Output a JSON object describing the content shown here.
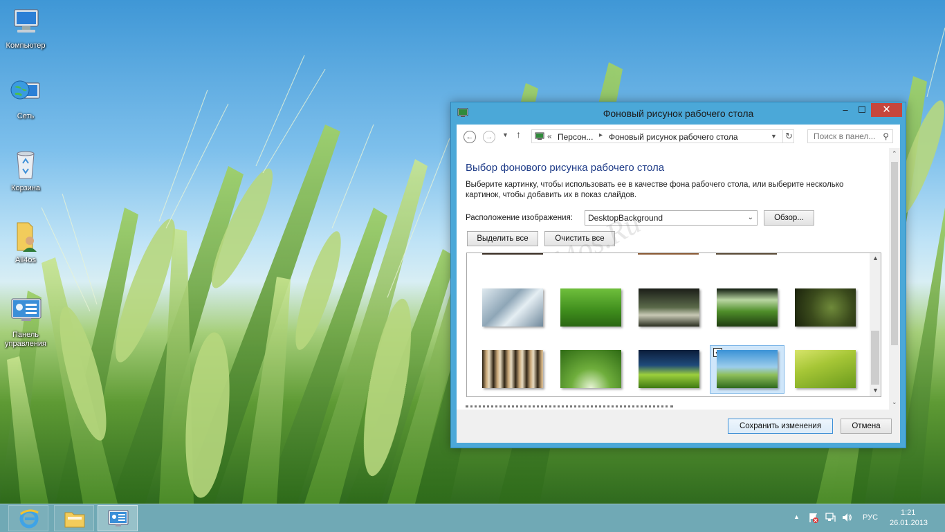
{
  "desktop": {
    "icons": [
      {
        "label": "Компьютер",
        "icon": "computer-icon"
      },
      {
        "label": "Сеть",
        "icon": "network-globe-icon"
      },
      {
        "label": "Корзина",
        "icon": "recycle-bin-icon"
      },
      {
        "label": "All4os",
        "icon": "user-folder-icon"
      },
      {
        "label_line1": "Панель",
        "label_line2": "управления",
        "icon": "control-panel-icon"
      }
    ]
  },
  "window": {
    "title": "Фоновый рисунок рабочего стола",
    "controls": {
      "minimize": "–",
      "maximize": "☐",
      "close": "✕"
    },
    "breadcrumb": {
      "prefix": "«",
      "items": [
        "Персон...",
        "Фоновый рисунок рабочего стола"
      ]
    },
    "search_placeholder": "Поиск в панел...",
    "heading": "Выбор фонового рисунка рабочего стола",
    "description": "Выберите картинку, чтобы использовать ее в качестве фона рабочего стола, или выберите несколько картинок, чтобы добавить их в показ слайдов.",
    "location_label": "Расположение изображения:",
    "location_value": "DesktopBackground",
    "browse_button": "Обзор...",
    "select_all_button": "Выделить все",
    "clear_all_button": "Очистить все",
    "watermark": "All4os.Ru",
    "wallpapers_selected_index": 8,
    "save_button": "Сохранить изменения",
    "cancel_button": "Отмена"
  },
  "taskbar": {
    "apps": [
      {
        "icon": "internet-explorer-icon",
        "active": false
      },
      {
        "icon": "file-explorer-icon",
        "active": false
      },
      {
        "icon": "control-panel-icon",
        "active": true
      }
    ],
    "tray": {
      "language": "РУС",
      "time": "1:21",
      "date": "26.01.2013"
    }
  },
  "colors": {
    "window_frame": "#4ba8d8",
    "close_button": "#c7463c",
    "heading_blue": "#1f3c88",
    "taskbar": "#5096a5"
  }
}
